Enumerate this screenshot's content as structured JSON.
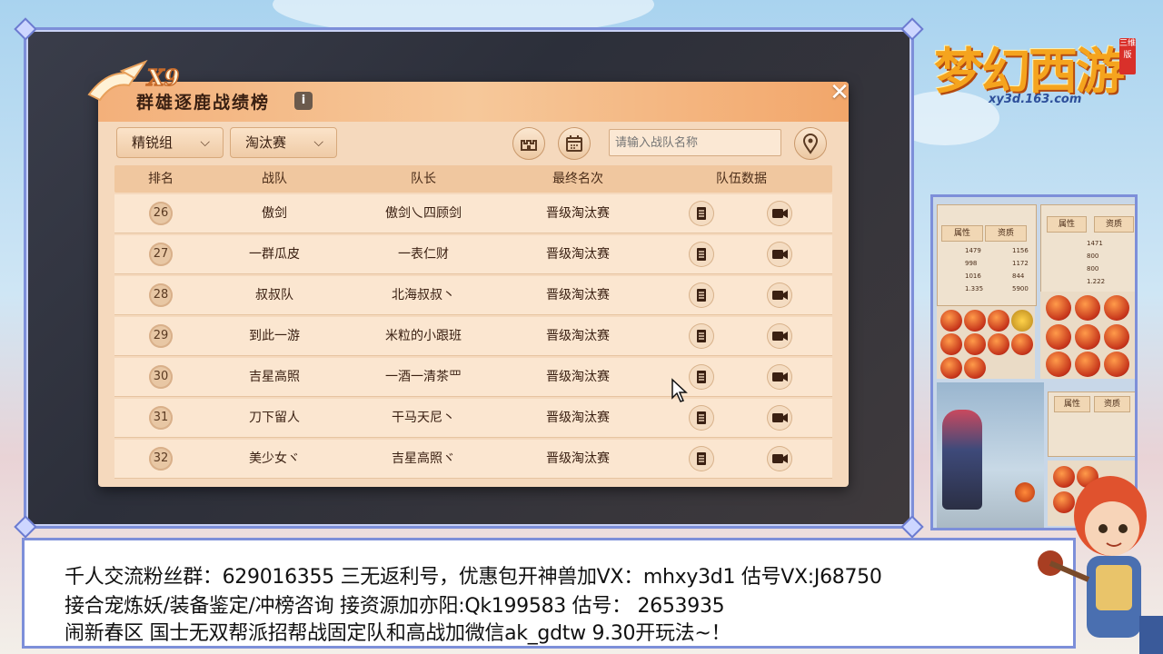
{
  "game_logo": {
    "title": "梦幻西游",
    "tag": "三维版",
    "url": "xy3d.163.com"
  },
  "panel": {
    "logo_text": "X9",
    "title": "群雄逐鹿战绩榜",
    "info_icon": "info-icon",
    "close_icon": "close-icon",
    "group_dropdown": "精锐组",
    "stage_dropdown": "淘汰赛",
    "search_placeholder": "请输入战队名称",
    "toolbar_icons": [
      "castle-icon",
      "calendar-icon",
      "location-pin-icon"
    ]
  },
  "table": {
    "headers": {
      "rank": "排名",
      "team": "战队",
      "captain": "队长",
      "final": "最终名次",
      "data": "队伍数据"
    },
    "rows": [
      {
        "rank": "26",
        "team": "傲剑",
        "captain": "傲剑乀四顾剑",
        "final": "晋级淘汰赛"
      },
      {
        "rank": "27",
        "team": "一群瓜皮",
        "captain": "一表仁财",
        "final": "晋级淘汰赛"
      },
      {
        "rank": "28",
        "team": "叔叔队",
        "captain": "北海叔叔丶",
        "final": "晋级淘汰赛"
      },
      {
        "rank": "29",
        "team": "到此一游",
        "captain": "米粒的小跟班",
        "final": "晋级淘汰赛"
      },
      {
        "rank": "30",
        "team": "吉星高照",
        "captain": "一酒一清茶罒",
        "final": "晋级淘汰赛"
      },
      {
        "rank": "31",
        "team": "刀下留人",
        "captain": "干马天尼丶",
        "final": "晋级淘汰赛"
      },
      {
        "rank": "32",
        "team": "美少女ヾ",
        "captain": "吉星高照ヾ",
        "final": "晋级淘汰赛"
      }
    ]
  },
  "side_view": {
    "tabs_left": [
      "属性",
      "资质"
    ],
    "tabs_right": [
      "属性",
      "资质"
    ],
    "stats_left": [
      "1479",
      "1156",
      "998",
      "1172",
      "1016",
      "844",
      "1.335",
      "5900"
    ],
    "stats_right": [
      "1471",
      "800",
      "800",
      "1.222"
    ]
  },
  "info_bar": {
    "line1": "千人交流粉丝群：629016355 三无返利号，优惠包开神兽加VX：mhxy3d1 估号VX:J68750",
    "line2": "接合宠炼妖/装备鉴定/冲榜咨询 接资源加亦阳:Qk199583 估号： 2653935",
    "line3": "闹新春区 国士无双帮派招帮战固定队和高战加微信ak_gdtw 9.30开玩法~！"
  },
  "colors": {
    "frame": "#7d8fd9",
    "panel_bg": "#f5d9bd",
    "header": "#f3b07a",
    "text_dark": "#3a2012"
  }
}
